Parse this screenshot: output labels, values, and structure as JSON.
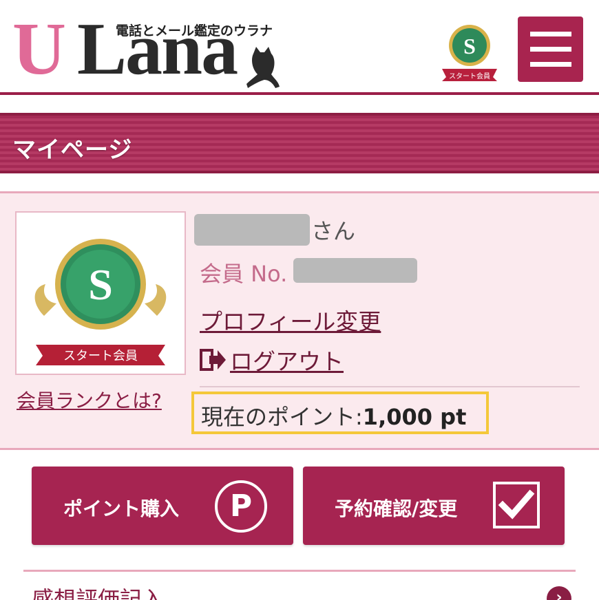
{
  "header": {
    "logo_u": "U",
    "logo_rest": "Lana",
    "logo_subtitle": "電話とメール鑑定のウラナ",
    "rank_badge_letter": "S",
    "rank_badge_ribbon": "スタート会員",
    "menu_icon": "hamburger-menu-icon"
  },
  "page_title": "マイページ",
  "profile": {
    "rank_badge_letter": "S",
    "rank_badge_ribbon": "スタート会員",
    "user_suffix": "さん",
    "member_no_label": "会員 No.",
    "profile_link": "プロフィール変更",
    "logout_link": "ログアウト",
    "rank_link": "会員ランクとは?",
    "points_label": "現在のポイント:",
    "points_value": "1,000 pt"
  },
  "actions": {
    "buy_points": "ポイント購入",
    "buy_points_icon_letter": "P",
    "reservation": "予約確認/変更"
  },
  "bottom": {
    "item_label": "感想評価記入"
  },
  "colors": {
    "brand": "#a62451",
    "brand_dark": "#8d1d43",
    "accent_pink": "#e06a97",
    "panel_bg": "#fbeaee",
    "highlight": "#f4c83a"
  }
}
